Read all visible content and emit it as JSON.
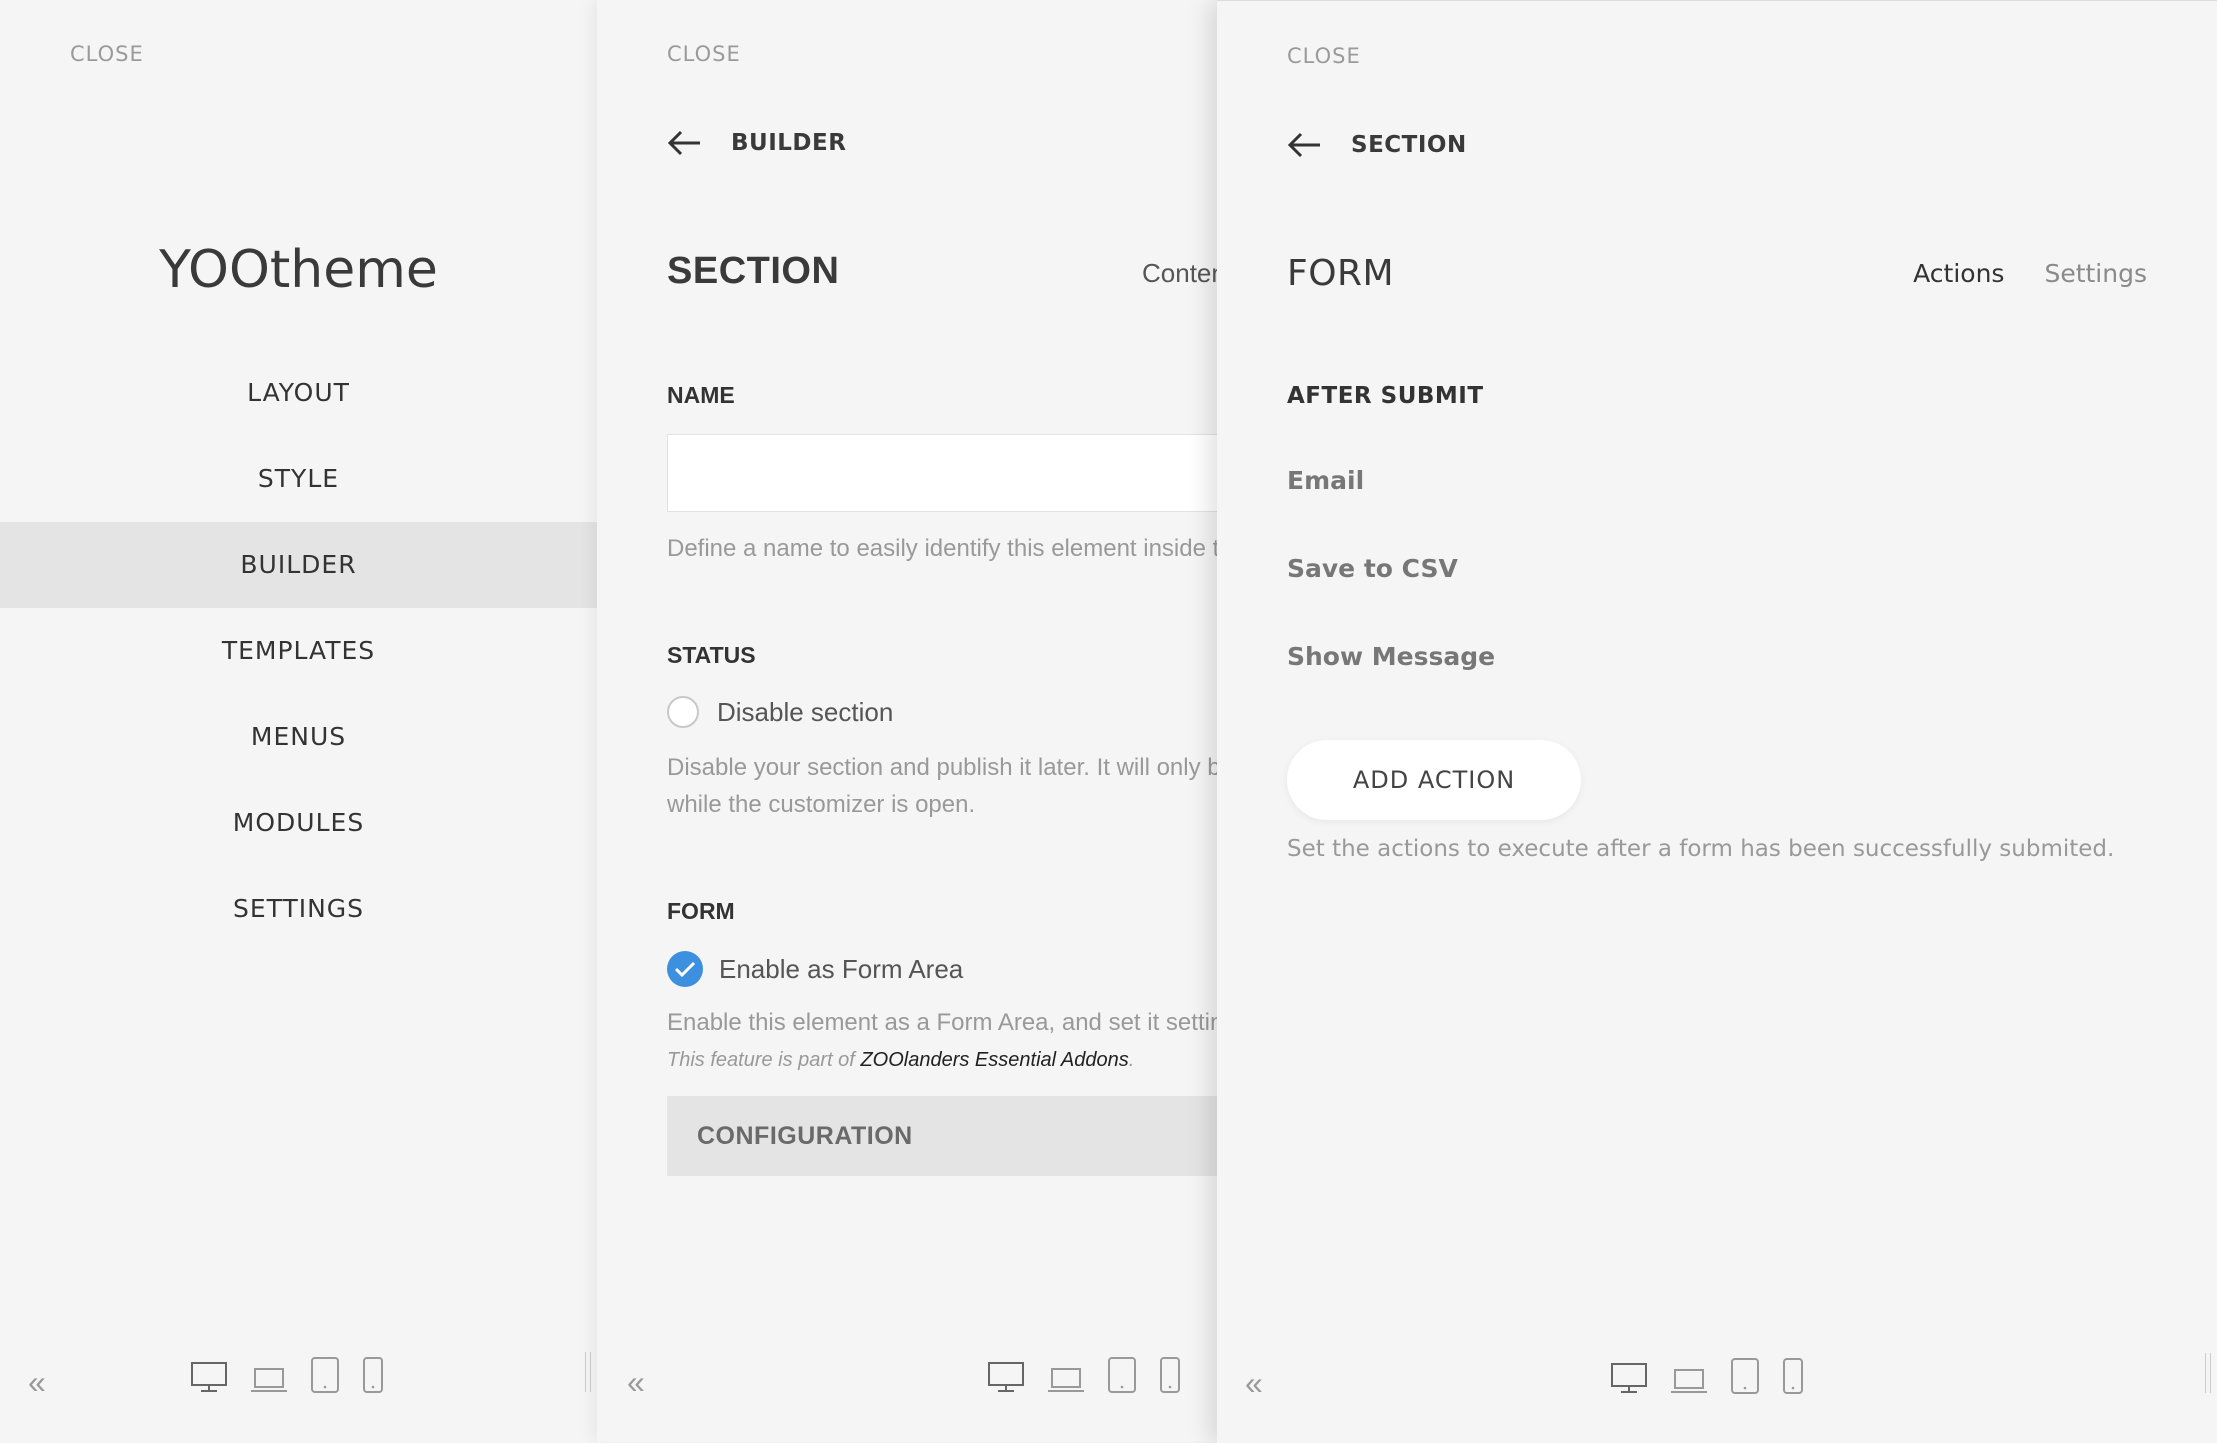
{
  "panel1": {
    "close": "CLOSE",
    "logo": "YOOtheme",
    "nav": [
      "LAYOUT",
      "STYLE",
      "BUILDER",
      "TEMPLATES",
      "MENUS",
      "MODULES",
      "SETTINGS"
    ],
    "active": "BUILDER"
  },
  "panel2": {
    "close": "CLOSE",
    "back_label": "BUILDER",
    "title": "SECTION",
    "tab_peek": "Content",
    "name_label": "NAME",
    "name_value": "",
    "name_help": "Define a name to easily identify this element inside the builder.",
    "status_label": "STATUS",
    "disable_label": "Disable section",
    "disable_checked": false,
    "disable_help_1": "Disable your section and publish it later. It will only be visible",
    "disable_help_2": "while the customizer is open.",
    "form_label": "FORM",
    "enable_label": "Enable as Form Area",
    "enable_checked": true,
    "enable_help": "Enable this element as a Form Area, and set it settings.",
    "feature_prefix": "This feature is part of",
    "feature_link": "ZOOlanders Essential Addons",
    "feature_suffix": ".",
    "config_button": "CONFIGURATION"
  },
  "panel3": {
    "close": "CLOSE",
    "back_label": "SECTION",
    "title": "FORM",
    "tabs": [
      "Actions",
      "Settings"
    ],
    "active_tab": "Actions",
    "after_submit_label": "AFTER SUBMIT",
    "actions": [
      "Email",
      "Save to CSV",
      "Show Message"
    ],
    "add_action": "ADD ACTION",
    "help": "Set the actions to execute after a form has been successfully submited."
  },
  "footer": {
    "collapse": "«",
    "devices": [
      "desktop-icon",
      "laptop-icon",
      "tablet-icon",
      "phone-icon"
    ]
  },
  "colors": {
    "accent": "#3d8fe0",
    "panel_bg": "#f5f5f5",
    "active_nav_bg": "#e4e4e4"
  }
}
